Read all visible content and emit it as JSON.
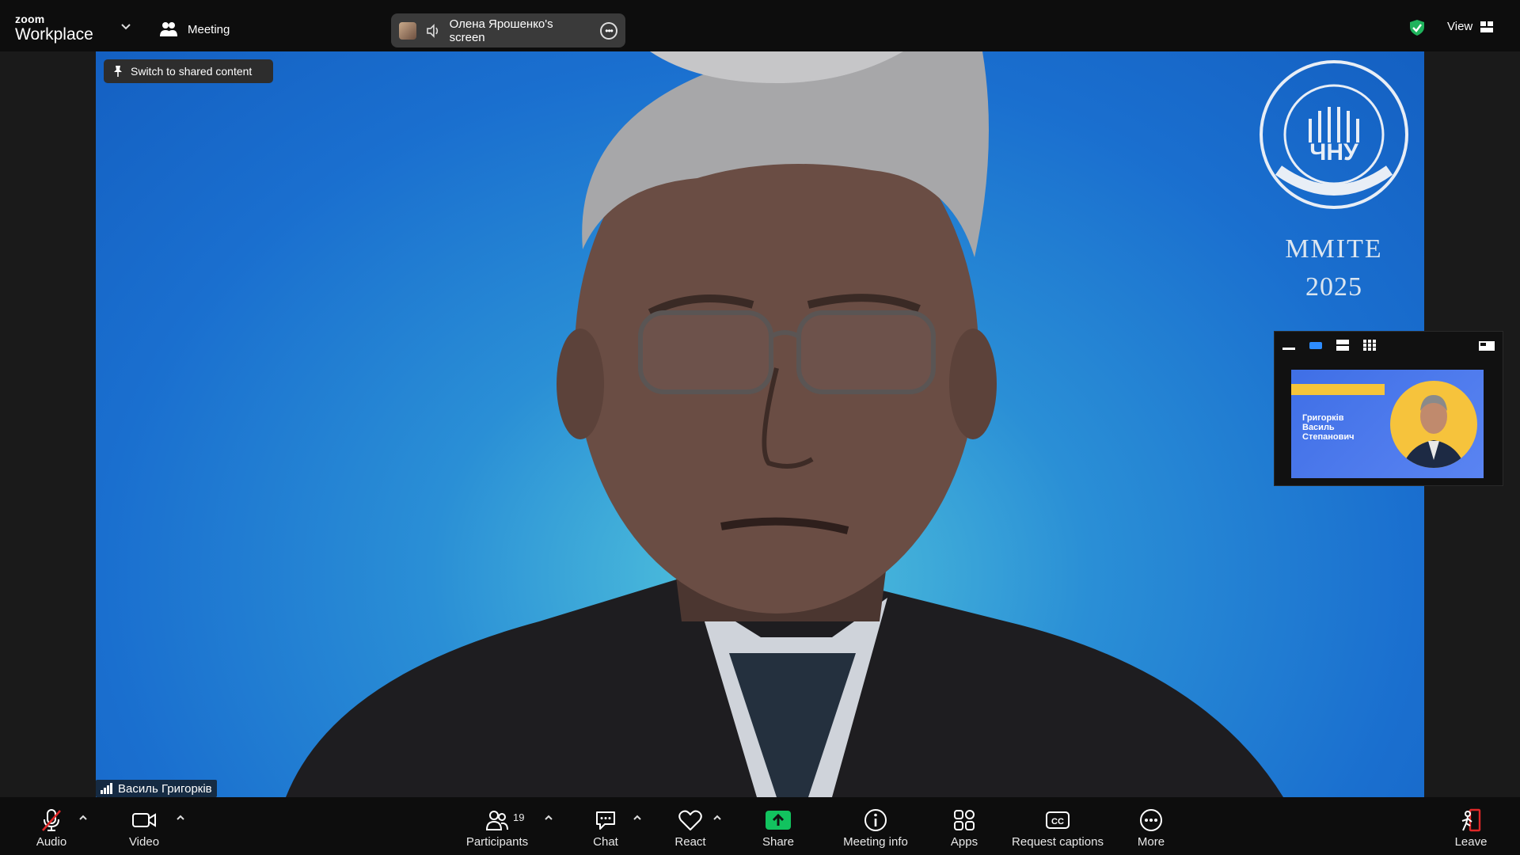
{
  "topbar": {
    "brand_small": "zoom",
    "brand_large": "Workplace",
    "meeting_label": "Meeting",
    "screen_share_label": "Олена Ярошенко's screen",
    "view_label": "View"
  },
  "main": {
    "switch_label": "Switch to shared content",
    "speaker_name": "Василь Григорків",
    "background_text_line1": "MMITE",
    "background_text_line2": "2025",
    "logo_text": "ЧНУ"
  },
  "thumbnail": {
    "name_line1": "Григорків",
    "name_line2": "Василь",
    "name_line3": "Степанович"
  },
  "toolbar": {
    "audio_label": "Audio",
    "video_label": "Video",
    "participants_label": "Participants",
    "participants_count": "19",
    "chat_label": "Chat",
    "react_label": "React",
    "share_label": "Share",
    "meeting_info_label": "Meeting info",
    "apps_label": "Apps",
    "captions_label": "Request captions",
    "more_label": "More",
    "leave_label": "Leave"
  },
  "colors": {
    "share_green": "#12c35f",
    "mute_red": "#e02828",
    "leave_red": "#e02828",
    "shield_green": "#1fb35c",
    "active_blue": "#2d8cff"
  }
}
